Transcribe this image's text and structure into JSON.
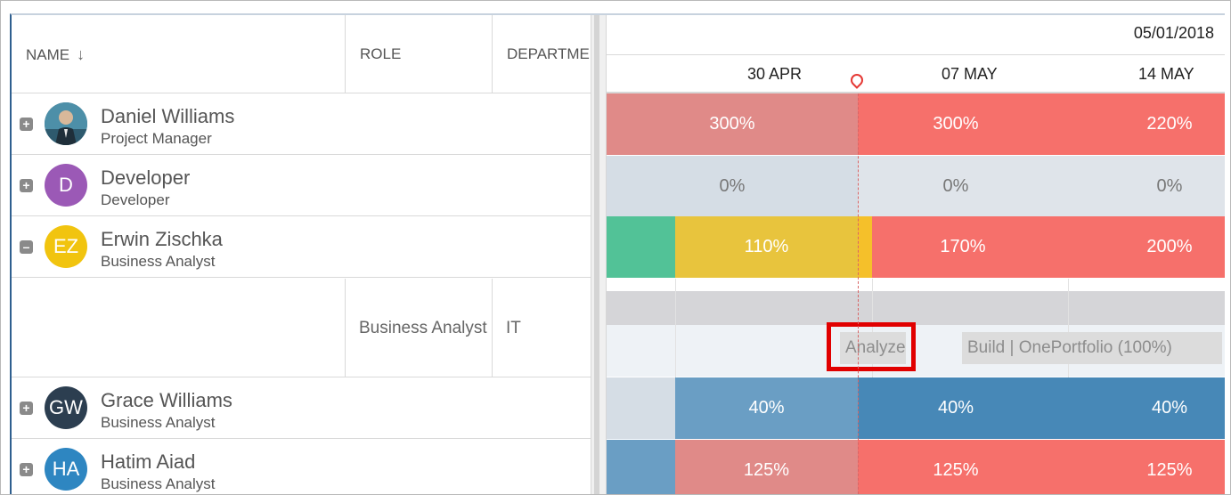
{
  "columns": {
    "name": "NAME",
    "role": "ROLE",
    "department": "DEPARTMENT"
  },
  "timeline": {
    "date": "05/01/2018",
    "weeks": [
      "30 APR",
      "07 MAY",
      "14 MAY"
    ]
  },
  "people": [
    {
      "name": "Daniel Williams",
      "role": "Project Manager",
      "initials": "",
      "avatar_color": "#3a6f8a",
      "expanded": false,
      "alloc": [
        "300%",
        "300%",
        "220%"
      ]
    },
    {
      "name": "Developer",
      "role": "Developer",
      "initials": "D",
      "avatar_color": "#9b59b6",
      "expanded": false,
      "alloc": [
        "0%",
        "0%",
        "0%"
      ]
    },
    {
      "name": "Erwin Zischka",
      "role": "Business Analyst",
      "initials": "EZ",
      "avatar_color": "#f1c40f",
      "expanded": true,
      "alloc": [
        "110%",
        "170%",
        "200%"
      ]
    },
    {
      "name": "Grace Williams",
      "role": "Business Analyst",
      "initials": "GW",
      "avatar_color": "#2c3e50",
      "expanded": false,
      "alloc": [
        "40%",
        "40%",
        "40%"
      ]
    },
    {
      "name": "Hatim Aiad",
      "role": "Business Analyst",
      "initials": "HA",
      "avatar_color": "#2e86c1",
      "expanded": false,
      "alloc": [
        "125%",
        "125%",
        "125%"
      ]
    }
  ],
  "assignment": {
    "role": "Business Analyst",
    "department": "IT",
    "tasks": [
      "Analyze",
      "Build | OnePortfolio (100%)"
    ]
  },
  "colors": {
    "over_past": "#e08a88",
    "over": "#f6706b",
    "zero_past": "#d5dde5",
    "zero": "#dfe4ea",
    "green": "#52c297",
    "yellow": "#e8c43d",
    "yellow_bright": "#f5c02a",
    "blue_past": "#6a9ec4",
    "blue": "#4788b7"
  }
}
